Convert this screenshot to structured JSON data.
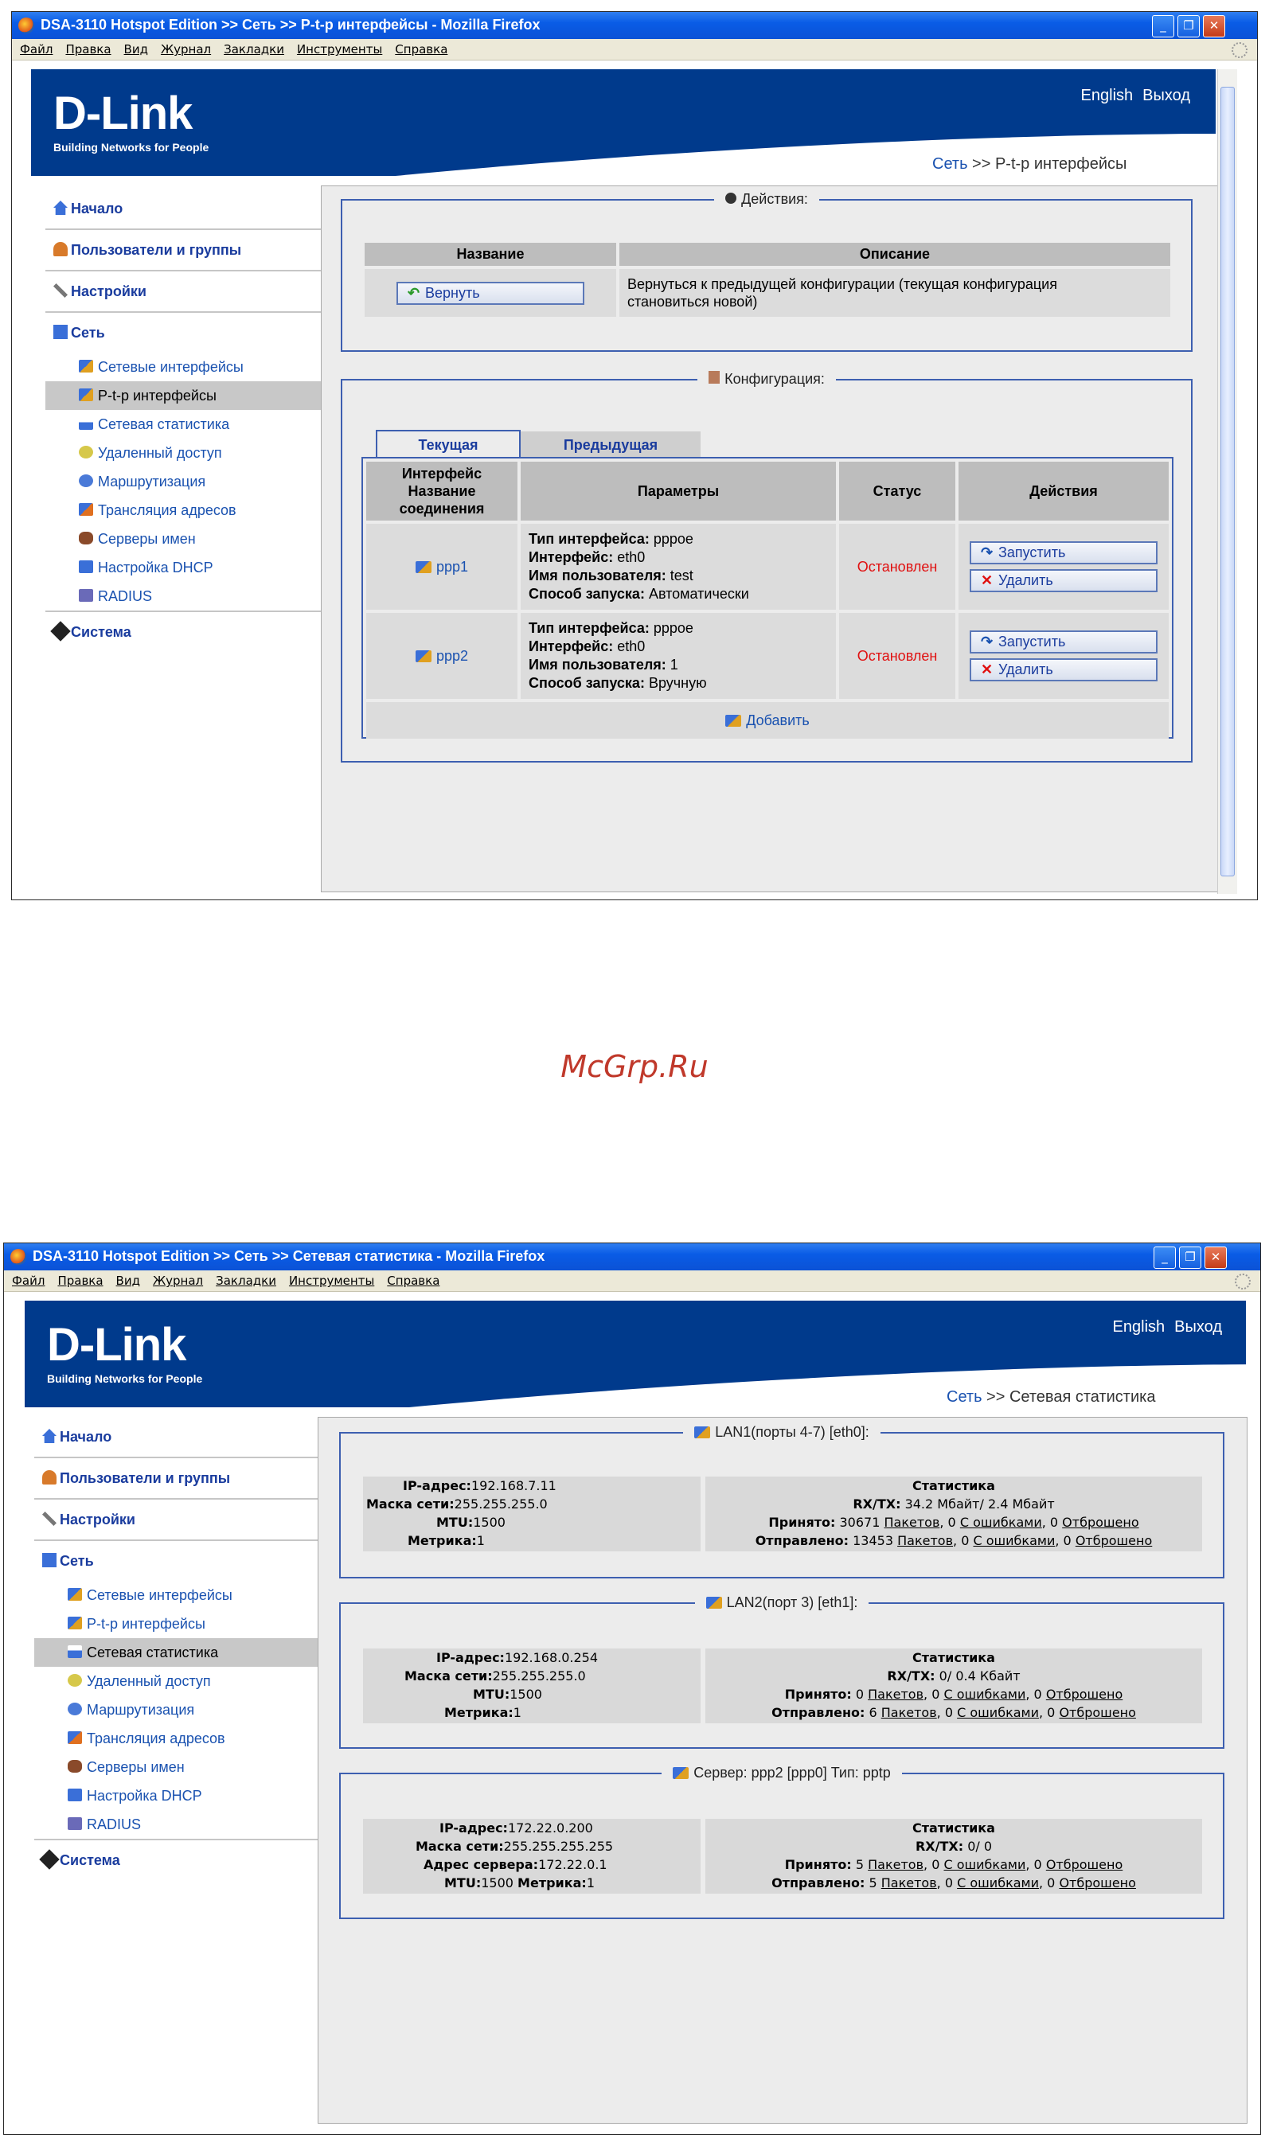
{
  "window1": {
    "title": "DSA-3110 Hotspot Edition >> Сеть >> P-t-p интерфейсы - Mozilla Firefox",
    "menu": [
      "Файл",
      "Правка",
      "Вид",
      "Журнал",
      "Закладки",
      "Инструменты",
      "Справка"
    ],
    "header": {
      "logo": "D-Link",
      "tagline": "Building Networks for People",
      "english": "English",
      "logout": "Выход"
    },
    "breadcrumb": {
      "link": "Сеть",
      "sep": " >> ",
      "current": "P-t-p интерфейсы"
    },
    "sidebar": {
      "home": "Начало",
      "users": "Пользователи и группы",
      "settings": "Настройки",
      "network": "Сеть",
      "sub": [
        "Сетевые интерфейсы",
        "P-t-p интерфейсы",
        "Сетевая статистика",
        "Удаленный доступ",
        "Маршрутизация",
        "Трансляция адресов",
        "Серверы имен",
        "Настройка DHCP",
        "RADIUS"
      ],
      "system": "Система"
    },
    "actions": {
      "legend": "Действия:",
      "col_name": "Название",
      "col_desc": "Описание",
      "revert_button": "Вернуть",
      "revert_desc_1": "Вернуться к предыдущей конфигурации (текущая конфигурация",
      "revert_desc_2": "становиться новой)"
    },
    "config": {
      "legend": "Конфигурация:",
      "tab_current": "Текущая",
      "tab_previous": "Предыдущая",
      "col_iface_1": "Интерфейс",
      "col_iface_2": "Название",
      "col_iface_3": "соединения",
      "col_params": "Параметры",
      "col_status": "Статус",
      "col_actions": "Действия",
      "lbl_type": "Тип интерфейса:",
      "lbl_iface": "Интерфейс:",
      "lbl_user": "Имя пользователя:",
      "lbl_start": "Способ запуска:",
      "start_button": "Запустить",
      "delete_button": "Удалить",
      "rows": [
        {
          "name": "ppp1",
          "type": "pppoe",
          "iface": "eth0",
          "user": "test",
          "start": "Автоматически",
          "status": "Остановлен"
        },
        {
          "name": "ppp2",
          "type": "pppoe",
          "iface": "eth0",
          "user": "1",
          "start": "Вручную",
          "status": "Остановлен"
        }
      ],
      "add_button": "Добавить"
    }
  },
  "watermark": "McGrp.Ru",
  "window2": {
    "title": "DSA-3110 Hotspot Edition >> Сеть >> Сетевая статистика - Mozilla Firefox",
    "menu": [
      "Файл",
      "Правка",
      "Вид",
      "Журнал",
      "Закладки",
      "Инструменты",
      "Справка"
    ],
    "header": {
      "logo": "D-Link",
      "tagline": "Building Networks for People",
      "english": "English",
      "logout": "Выход"
    },
    "breadcrumb": {
      "link": "Сеть",
      "sep": " >> ",
      "current": "Сетевая статистика"
    },
    "sidebar": {
      "home": "Начало",
      "users": "Пользователи и группы",
      "settings": "Настройки",
      "network": "Сеть",
      "sub": [
        "Сетевые интерфейсы",
        "P-t-p интерфейсы",
        "Сетевая статистика",
        "Удаленный доступ",
        "Маршрутизация",
        "Трансляция адресов",
        "Серверы имен",
        "Настройка DHCP",
        "RADIUS"
      ],
      "system": "Система"
    },
    "labels": {
      "ip": "IP-адрес:",
      "mask": "Маска сети:",
      "mtu": "MTU:",
      "metric": "Метрика:",
      "server_addr": "Адрес сервера:",
      "stats": "Статистика",
      "rxtx": "RX/TX:",
      "received": "Принято:",
      "sent": "Отправлено:",
      "packets": "Пакетов",
      "errors": "С ошибками",
      "dropped": "Отброшено"
    },
    "groups": [
      {
        "legend": "LAN1(порты 4-7) [eth0]:",
        "ip": "192.168.7.11",
        "mask": "255.255.255.0",
        "mtu": "1500",
        "metric": "1",
        "rxtx": "34.2 Мбайт/ 2.4 Мбайт",
        "rx": {
          "packets": "30671",
          "errors": "0",
          "dropped": "0"
        },
        "tx": {
          "packets": "13453",
          "errors": "0",
          "dropped": "0"
        }
      },
      {
        "legend": "LAN2(порт 3) [eth1]:",
        "ip": "192.168.0.254",
        "mask": "255.255.255.0",
        "mtu": "1500",
        "metric": "1",
        "rxtx": "0/ 0.4 Кбайт",
        "rx": {
          "packets": "0",
          "errors": "0",
          "dropped": "0"
        },
        "tx": {
          "packets": "6",
          "errors": "0",
          "dropped": "0"
        }
      },
      {
        "legend": "Сервер: ppp2 [ppp0] Тип: pptp",
        "ip": "172.22.0.200",
        "mask": "255.255.255.255",
        "server": "172.22.0.1",
        "mtu": "1500",
        "metric": "1",
        "rxtx": "0/ 0",
        "rx": {
          "packets": "5",
          "errors": "0",
          "dropped": "0"
        },
        "tx": {
          "packets": "5",
          "errors": "0",
          "dropped": "0"
        }
      }
    ]
  },
  "colors": {
    "brand_blue": "#003a8c",
    "link": "#1a52b0",
    "status_red": "#e01010",
    "titlebar": "#0a5ce6"
  }
}
